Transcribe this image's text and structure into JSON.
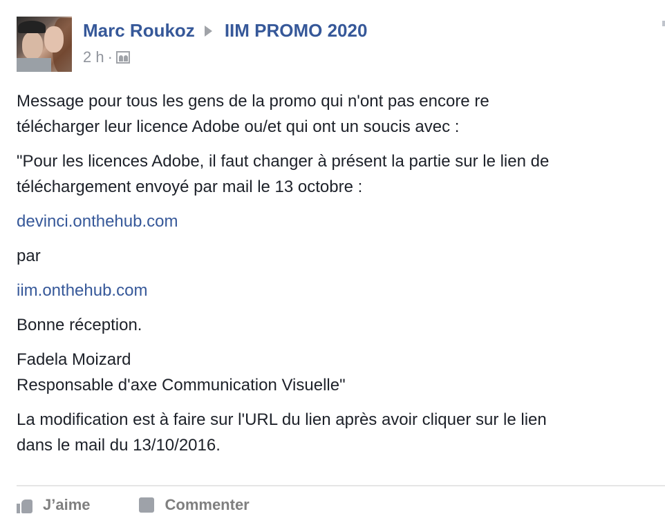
{
  "post": {
    "author": "Marc Roukoz",
    "group": "IIM PROMO 2020",
    "time": "2 h",
    "separator": "·",
    "audience_icon": "group-icon",
    "paragraphs": {
      "p1a": "Message pour tous les gens de la promo qui n'ont pas encore re",
      "p1b": "télécharger leur licence Adobe ou/et qui ont un soucis avec :",
      "p2a": "\"Pour les licences Adobe, il faut changer à présent la partie sur le lien de",
      "p2b": "téléchargement envoyé par mail le 13 octobre :",
      "link1": "devinci.onthehub.com",
      "par": "par",
      "link2": "iim.onthehub.com",
      "bonne": "Bonne réception.",
      "sig_name": "Fadela Moizard",
      "sig_title": "Responsable d'axe Communication Visuelle\"",
      "p_last_a": "La modification est à faire sur l'URL du lien après avoir cliquer sur le lien",
      "p_last_b": "dans le mail du 13/10/2016."
    }
  },
  "actions": {
    "like": "J’aime",
    "comment": "Commenter"
  },
  "colors": {
    "link": "#365899",
    "text": "#1d2129",
    "meta": "#90949c"
  }
}
